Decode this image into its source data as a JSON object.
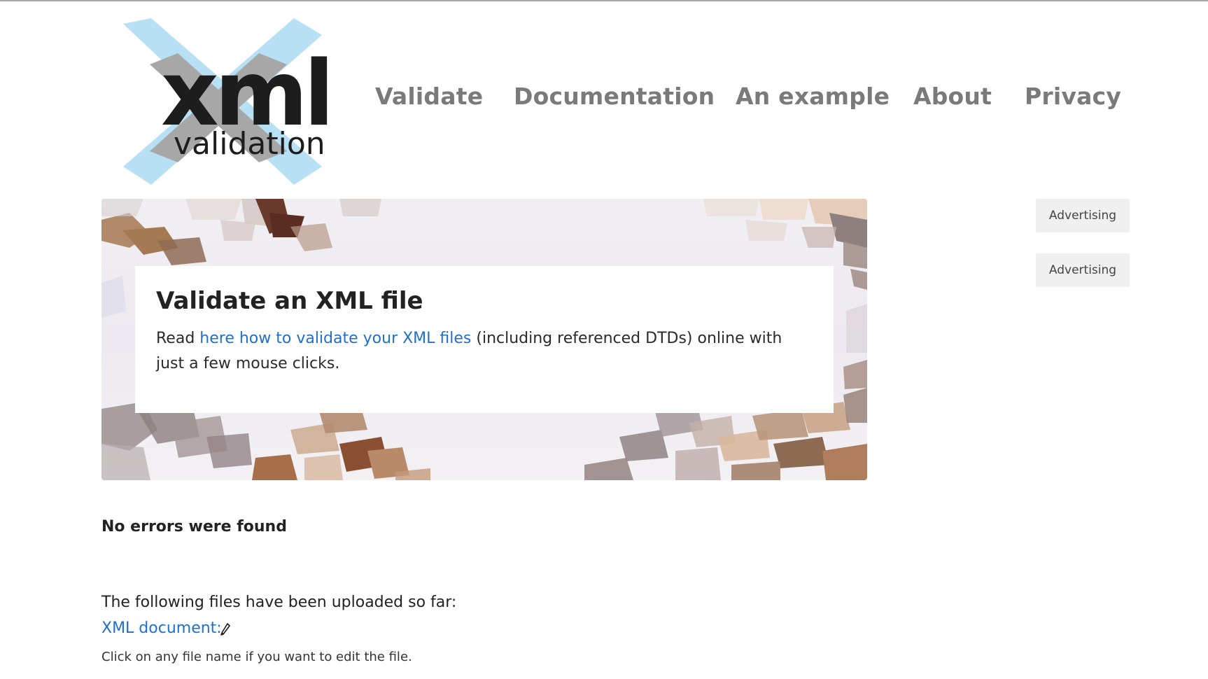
{
  "logo": {
    "word": "xml",
    "subword": "validation",
    "colors": {
      "x_light": "#b8e0f5",
      "x_grey": "#a7a7a7",
      "text": "#1d1d1d"
    }
  },
  "nav": {
    "items": [
      {
        "label": "Validate"
      },
      {
        "label": "Documentation"
      },
      {
        "label": "An example"
      },
      {
        "label": "About"
      },
      {
        "label": "Privacy"
      }
    ]
  },
  "hero": {
    "title": "Validate an XML file",
    "text_before": "Read ",
    "link_text": "here how to validate your XML files",
    "text_after": " (including referenced DTDs) online with just a few mouse clicks."
  },
  "ads": [
    "Advertising",
    "Advertising"
  ],
  "main": {
    "result": "No errors were found",
    "uploaded_label": "The following files have been uploaded so far:",
    "file_link": "XML document:",
    "file_icon": "pencil-icon",
    "hint": "Click on any file name if you want to edit the file."
  },
  "colors": {
    "link": "#1f6fcf",
    "nav": "#7a7a7a",
    "ad_bg": "#f0f0f0"
  }
}
